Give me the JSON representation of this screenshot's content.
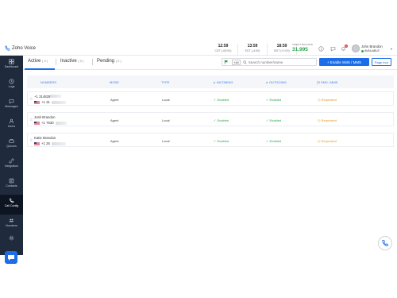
{
  "app": {
    "title": "Zoho Voice"
  },
  "clocks": [
    {
      "time": "12:59",
      "zone": "CDT (-05:00)"
    },
    {
      "time": "13:59",
      "zone": "EDT (-4:00)"
    },
    {
      "time": "18:59",
      "zone": "BST (+1:00)"
    }
  ],
  "credit": {
    "label": "CREDIT BALANCE",
    "value": "31.995"
  },
  "notifications": {
    "count": "1"
  },
  "user": {
    "name": "John Brandon",
    "status": "AVAILABLE"
  },
  "sidebar": {
    "items": [
      {
        "label": "Dashboard",
        "icon": "dashboard-icon"
      },
      {
        "label": "Logs",
        "icon": "logs-icon"
      },
      {
        "label": "Messages",
        "icon": "messages-icon"
      },
      {
        "label": "Users",
        "icon": "users-icon"
      },
      {
        "label": "Queues",
        "icon": "queues-icon"
      },
      {
        "label": "Integration",
        "icon": "integration-icon"
      },
      {
        "label": "Contacts",
        "icon": "contacts-icon"
      },
      {
        "label": "Call Config",
        "icon": "call-config-icon"
      },
      {
        "label": "Numbers",
        "icon": "numbers-icon"
      }
    ]
  },
  "tabs": [
    {
      "label": "Active",
      "count": "( 3 )"
    },
    {
      "label": "Inactive",
      "count": "( 0 )"
    },
    {
      "label": "Pending",
      "count": "( 0 )"
    }
  ],
  "filter": {
    "country_code": "+44",
    "placeholder": "Search number/name"
  },
  "actions": {
    "enable_sms": "+ Enable SMS / MMS",
    "page_tour": "Page tour"
  },
  "table": {
    "headers": [
      "NUMBERS",
      "MODE",
      "TYPE",
      "INCOMING",
      "OUTGOING",
      "SMS / MMS"
    ],
    "rows": [
      {
        "name": "+1 314828",
        "number": "+1 31",
        "mode": "Agent",
        "type": "Local",
        "incoming": "✓ Enabled",
        "outgoing": "✓ Enabled",
        "sms": "Requested"
      },
      {
        "name": "Josh Brandon",
        "number": "+1 7630",
        "mode": "Agent",
        "type": "Local",
        "incoming": "✓ Enabled",
        "outgoing": "✓ Enabled",
        "sms": "Requested"
      },
      {
        "name": "Katie Brandon",
        "number": "+1 25",
        "mode": "Agent",
        "type": "Local",
        "incoming": "✓ Enabled",
        "outgoing": "✓ Enabled",
        "sms": "Requested"
      }
    ]
  },
  "colors": {
    "accent": "#1c6ee8",
    "sidebar": "#1f2a3c",
    "enabled": "#2aa54b",
    "requested": "#e39a1c"
  }
}
